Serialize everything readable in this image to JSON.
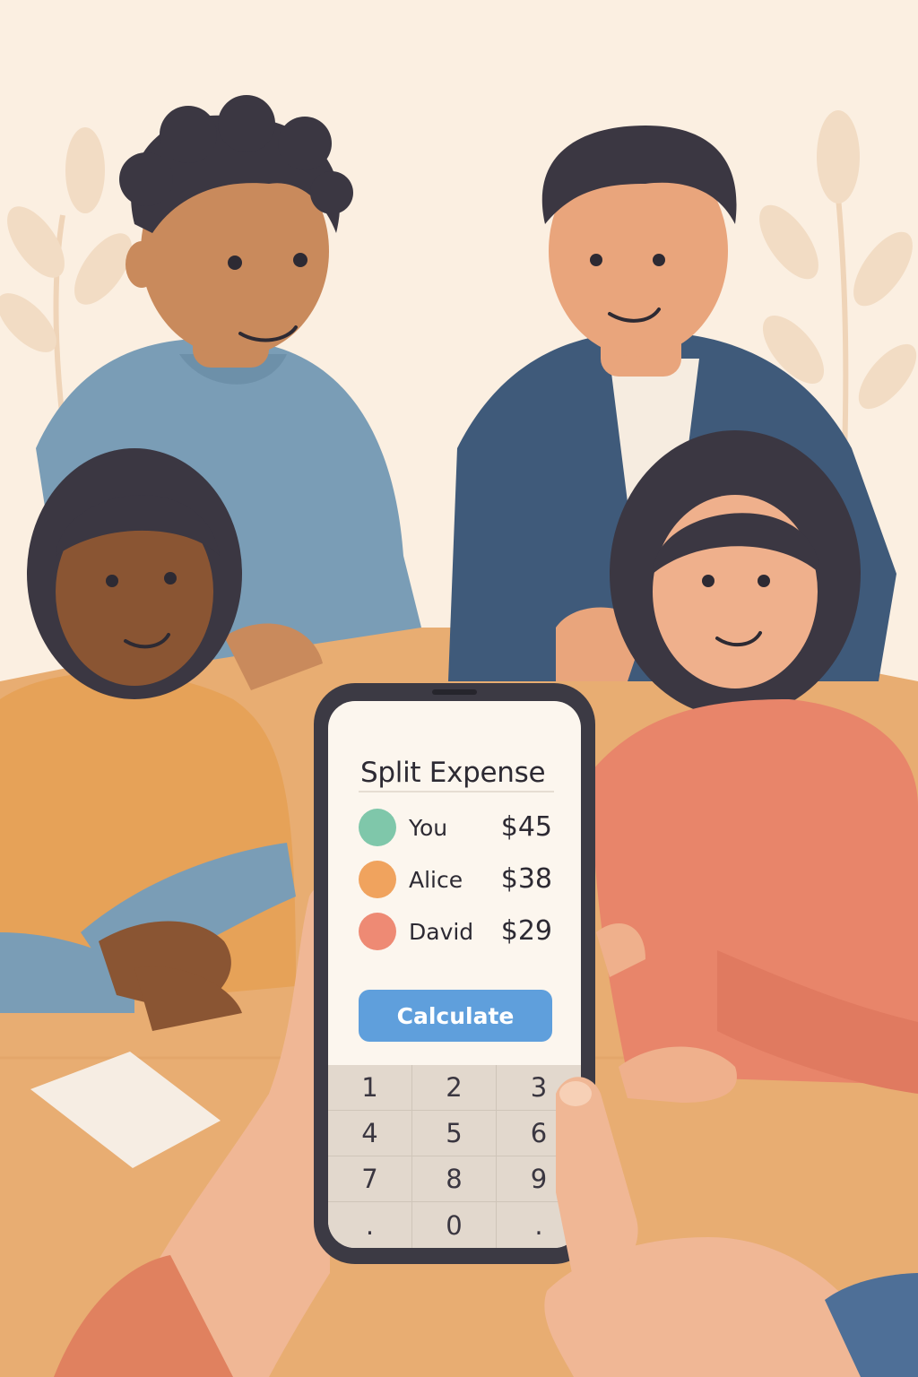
{
  "app": {
    "title": "Split Expense",
    "participants": [
      {
        "name": "You",
        "amount": "$45",
        "color": "#7fc7aa"
      },
      {
        "name": "Alice",
        "amount": "$38",
        "color": "#f0a35e"
      },
      {
        "name": "David",
        "amount": "$29",
        "color": "#ee8a74"
      }
    ],
    "calculate_label": "Calculate",
    "keypad": [
      "1",
      "2",
      "3",
      "4",
      "5",
      "6",
      "7",
      "8",
      "9",
      ".",
      "0",
      "."
    ]
  },
  "colors": {
    "accent": "#5f9fdc",
    "background": "#fbefe1",
    "table": "#e8ad72"
  }
}
